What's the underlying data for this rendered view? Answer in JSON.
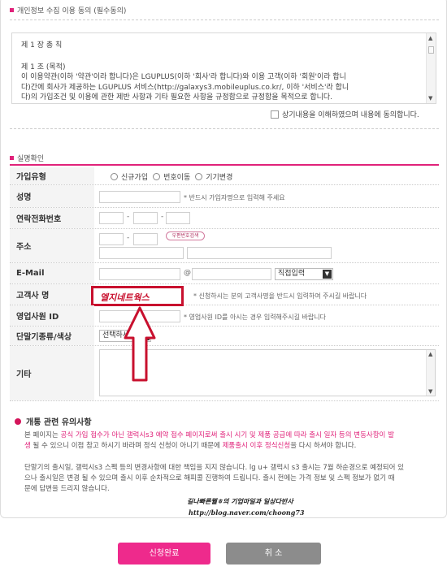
{
  "privacy": {
    "title": "개인정보 수집 이용 동의 (필수동의)",
    "terms_lines": [
      "제 1 장 총 칙",
      "제 1 조 (목적)",
      "이 이용약관(이하 '약관'이라 합니다)은 LGUPLUS(이하 '회사'라 합니다)와 이용 고객(이하 '회원'이라 합니",
      "다)간에 회사가 제공하는 LGUPLUS 서비스(http://galaxys3.mobileuplus.co.kr/, 이하 '서비스'라 합니",
      "다)의 가입조건 및 이용에 관한 제반 사항과 기타 필요한 사항을 규정함으로 규정함을 목적으로 합니다."
    ],
    "agree_label": "상기내용을 이해하였으며 내용에 동의합니다."
  },
  "confirm": {
    "title": "실명확인",
    "join_type": {
      "label": "가입유형",
      "options": [
        "신규가입",
        "번호이동",
        "기기변경"
      ]
    },
    "name": {
      "label": "성명",
      "hint": "* 반드시 가입자명으로 입력해 주세요"
    },
    "phone": {
      "label": "연락전화번호",
      "sep": "-"
    },
    "address": {
      "label": "주소",
      "zip_button": "우편번호검색",
      "sep": "-"
    },
    "email": {
      "label": "E-Mail",
      "at": "@",
      "select_value": "직접입력"
    },
    "customer": {
      "label": "고객사 명",
      "value": "엘지네트웍스",
      "hint": "* 신청하시는 분의 고객사명을 반드시 입력하여 주시길 바랍니다"
    },
    "sales_id": {
      "label": "영업사원 ID",
      "hint": "* 영업사원 ID를 아시는 경우 입력해주시길 바랍니다"
    },
    "device": {
      "label": "단말기종류/색상",
      "select_value": "선택하세요"
    },
    "etc": {
      "label": "기타"
    }
  },
  "notice": {
    "title": "개통 관련 유의사항",
    "p1_a": "본 페이지는 ",
    "p1_pink1": "공식 가입 접수가 아닌 갤럭시s3 예약 접수 페이지로써 출시 시기 및 제품 공급에 따라 출시 일자 등의 변동사항이 발",
    "p1_pink2": "생",
    "p1_b": " 될 수 있으니 이점 참고 하시기 바라며 정식 신청이 아니기 때문에 ",
    "p1_pink3": "제품출시 이후 정식신청",
    "p1_c": "을 다시 하셔야 합니다.",
    "p2_lines": [
      "단말기의 출시일, 갤럭시s3 스펙 등의 변경사항에 대한 책임을 지지 않습니다. lg u+ 갤럭시 s3 출시는 7월 하순경으로 예정되어 있",
      "으나 출시일은 변경 될 수 있으며 출시 이후 순차적으로 해피콜 진행하여 드립니다. 출시 전에는 가격 정보 및 스펙 정보가 없기 때",
      "문에 답변을 드리지 않습니다."
    ]
  },
  "watermark": {
    "line1": "길나빠른웰ㅎ의 기업마일과 일상다반사",
    "line2": "http://blog.naver.com/choong73"
  },
  "buttons": {
    "submit": "신청완료",
    "cancel": "취 소"
  },
  "colors": {
    "accent": "#e0227a",
    "annotation": "#c8102e",
    "cancel": "#8c8c8c"
  }
}
